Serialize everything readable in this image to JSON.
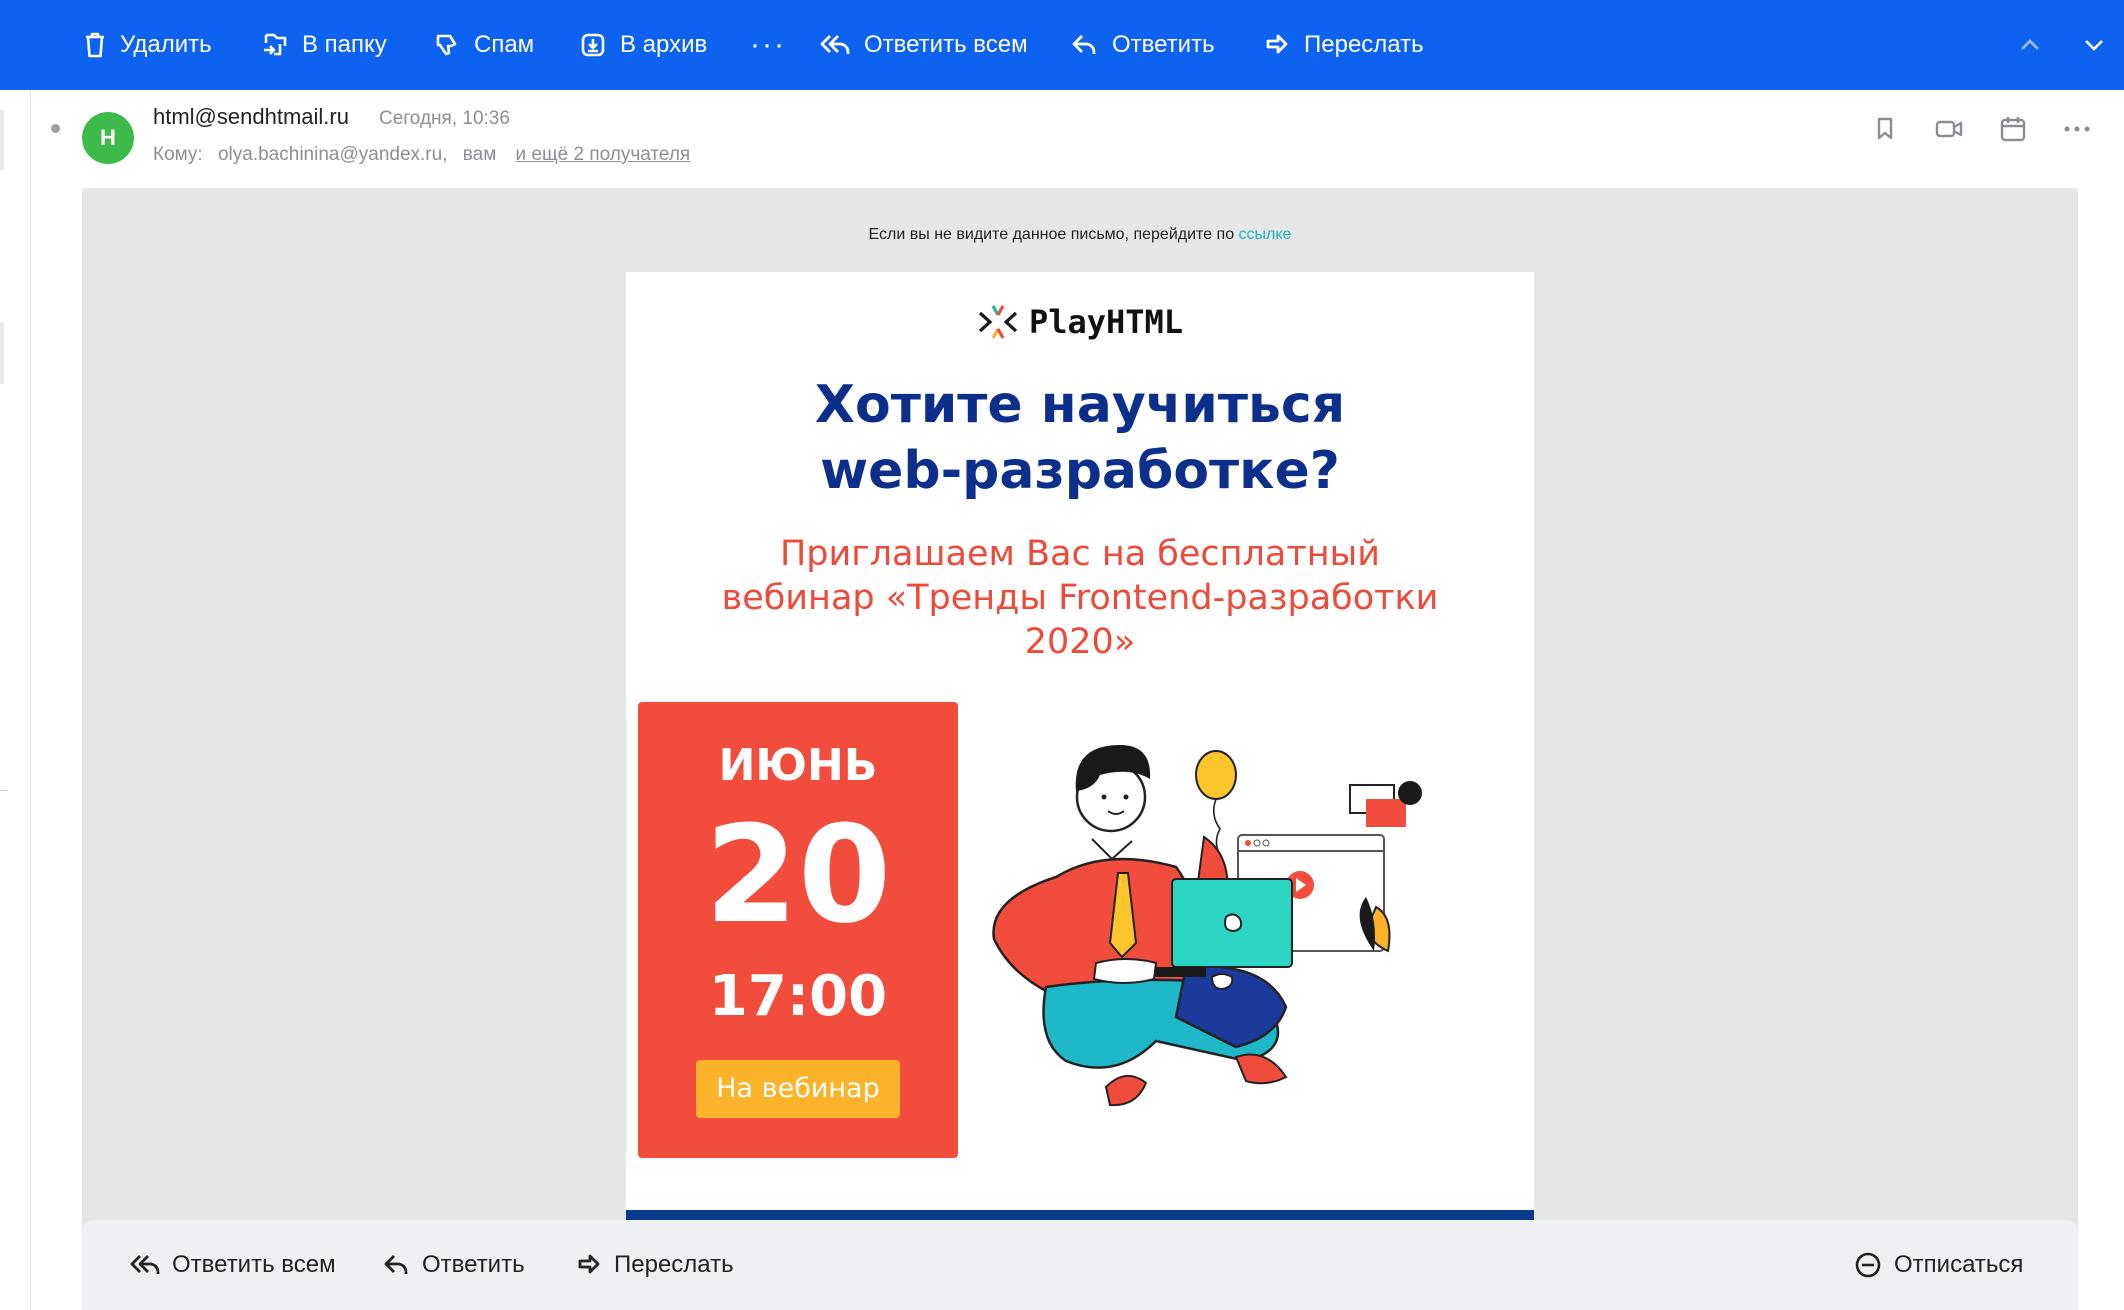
{
  "toolbar": {
    "delete_label": "Удалить",
    "folder_label": "В папку",
    "spam_label": "Спам",
    "archive_label": "В архив",
    "more_label": "···",
    "reply_all_label": "Ответить всем",
    "reply_label": "Ответить",
    "forward_label": "Переслать"
  },
  "message": {
    "avatar_letter": "H",
    "sender": "html@sendhtmail.ru",
    "date": "Сегодня, 10:36",
    "to_label": "Кому:",
    "to_address": "olya.bachinina@yandex.ru,",
    "to_you": "вам",
    "more_recipients": "и ещё 2 получателя"
  },
  "email": {
    "preheader_text": "Если вы не видите данное письмо, перейдите по ",
    "preheader_link": "ссылке",
    "logo_text": "PlayHTML",
    "headline_line1": "Хотите научиться",
    "headline_line2": "web-разработке?",
    "subline_line1": "Приглашаем Вас на бесплатный",
    "subline_line2": "вебинар «Тренды Frontend-разработки",
    "subline_line3": "2020»",
    "month": "ИЮНЬ",
    "day": "20",
    "time": "17:00",
    "cta_label": "На вебинар"
  },
  "bottombar": {
    "reply_all_label": "Ответить всем",
    "reply_label": "Ответить",
    "forward_label": "Переслать",
    "unsubscribe_label": "Отписаться"
  },
  "colors": {
    "toolbar_bg": "#0d62f0",
    "avatar_bg": "#3dbb4a",
    "headline": "#0d2f8c",
    "subline": "#ee4a3a",
    "date_card": "#f24c3d",
    "cta": "#fbb42a",
    "link": "#20b3c4"
  }
}
